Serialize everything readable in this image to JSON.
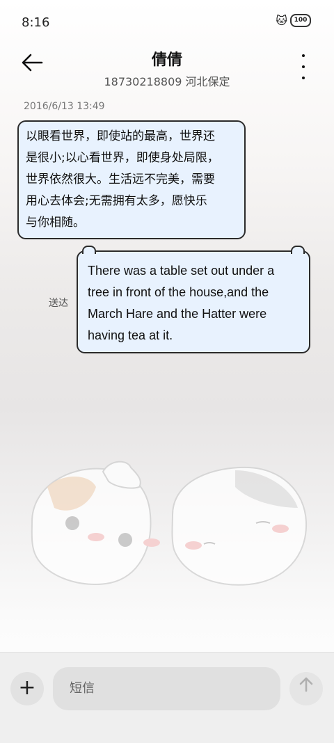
{
  "status_bar": {
    "time": "8:16",
    "battery": "100"
  },
  "header": {
    "contact_name": "倩倩",
    "contact_subtitle": "18730218809 河北保定"
  },
  "conversation": {
    "timestamp": "2016/6/13 13:49",
    "received_message_lines": [
      "以眼看世界，即使站的最高，世界还",
      "是很小;以心看世界，即使身处局限，",
      "世界依然很大。生活远不完美，需要",
      "用心去体会;无需拥有太多，愿快乐",
      "与你相随。"
    ],
    "sent_message_lines": [
      "There was a table set out under a",
      "tree in front of the house,and the",
      "March Hare and the Hatter were",
      "having tea at it."
    ],
    "sent_status": "送达"
  },
  "composer": {
    "placeholder": "短信"
  },
  "colors": {
    "bubble_bg": "#e8f2fe",
    "bubble_border": "#2b2b2b"
  }
}
